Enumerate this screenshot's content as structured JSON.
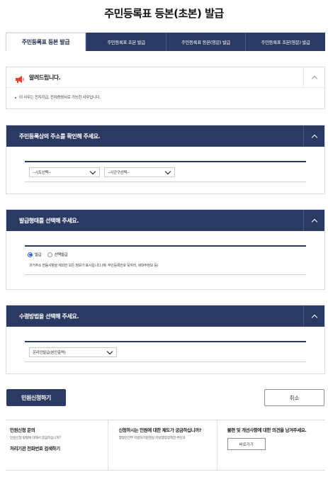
{
  "page": {
    "title": "주민등록표 등본(초본) 발급"
  },
  "tabs": [
    {
      "label": "주민등록표 등본 발급",
      "active": true
    },
    {
      "label": "주민등록표 초본 발급",
      "active": false
    },
    {
      "label": "주민등록표 등본(영문) 발급",
      "active": false
    },
    {
      "label": "주민등록표 초본(영문) 발급",
      "active": false
    }
  ],
  "notice": {
    "title": "알려드립니다.",
    "icon": "megaphone-icon",
    "items": [
      "이 사무는 전자지급, 전자증명서로 가능한 사무입니다."
    ]
  },
  "address_panel": {
    "title": "주민등록상의 주소를 확인해 주세요.",
    "sido": {
      "value": "--시도선택--"
    },
    "sigungu": {
      "value": "--시군구선택--"
    }
  },
  "format_panel": {
    "title": "발급형태를 선택해 주세요.",
    "options": [
      {
        "label": "발급",
        "selected": true
      },
      {
        "label": "선택발급",
        "selected": false
      }
    ],
    "note": "과거주소 변동사항을 제외한 모든 정보가 표시됩니다.(예: 주민등록번호 뒷자리, 세대주정보 등)"
  },
  "receipt_panel": {
    "title": "수령방법을 선택해 주세요.",
    "method": {
      "value": "온라인발급(본인출력)"
    }
  },
  "actions": {
    "apply": "민원신청하기",
    "cancel": "취소"
  },
  "footer": {
    "col1": {
      "title": "민원신청 문의",
      "sub": "민원신청 방법에 대해서 궁금하십니까?",
      "link": "처리기관 전화번호 검색하기"
    },
    "col2": {
      "title": "신청하시는 민원에 대한 제도가 궁금하십니까?",
      "sub": "행정안전부 지방자치분권실 지방행정정책관 주민과"
    },
    "col3": {
      "title": "불편 및 개선사항에 대한 의견을 남겨주세요.",
      "button": "바로가기"
    }
  },
  "colors": {
    "navy": "#2b3a63",
    "radio_on": "#2b5fc4"
  }
}
